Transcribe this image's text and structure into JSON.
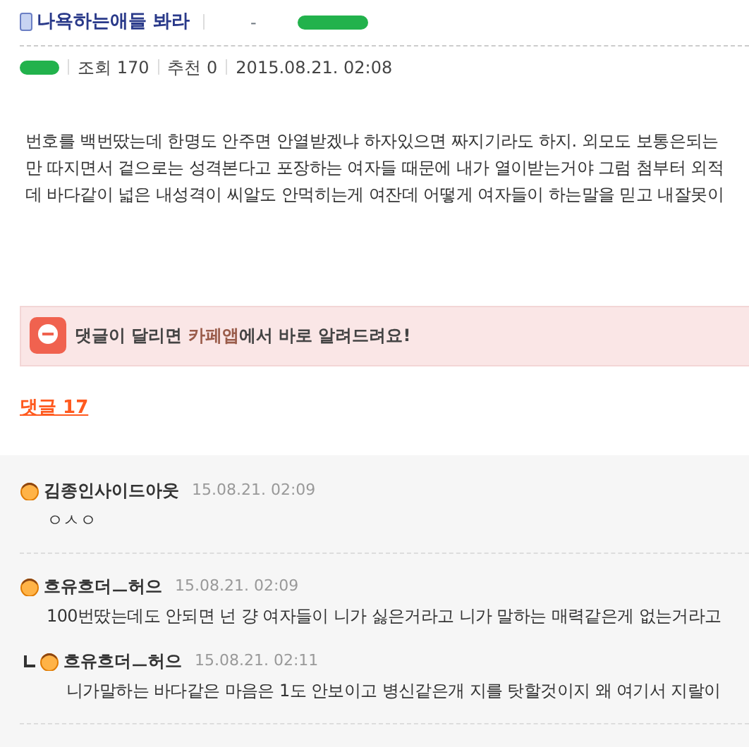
{
  "post": {
    "title": "나욕하는애들 봐라",
    "title_separator": "-",
    "views_label": "조회",
    "views": "170",
    "likes_label": "추천",
    "likes": "0",
    "date": "2015.08.21. 02:08",
    "body": [
      "번호를 백번땄는데 한명도 안주면 안열받겠냐 하자있으면 짜지기라도 하지. 외모도 보통은되는",
      "만 따지면서 겉으로는 성격본다고 포장하는 여자들 때문에 내가 열이받는거야 그럼 첨부터 외적",
      "데 바다같이 넓은 내성격이 씨알도 안먹히는게 여잔데 어떻게 여자들이 하는말을 믿고 내잘못이"
    ]
  },
  "banner": {
    "text_before": "댓글이 달리면 ",
    "highlight": "카페앱",
    "text_after": "에서 바로 알려드려요!"
  },
  "comments_header": "댓글 17",
  "comments": [
    {
      "author": "김종인사이드아웃",
      "time": "15.08.21. 02:09",
      "text": "ㅇㅅㅇ"
    },
    {
      "author": "흐유흐더ㅡ허으",
      "time": "15.08.21. 02:09",
      "text": "100번땄는데도 안되면 넌 걍 여자들이 니가 싫은거라고 니가 말하는 매력같은게 없는거라고",
      "children": [
        {
          "author": "흐유흐더ㅡ허으",
          "time": "15.08.21. 02:11",
          "text": "니가말하는 바다같은 마음은 1도 안보이고 병신같은개 지를 탓할것이지 왜 여기서 지랄이"
        }
      ]
    }
  ]
}
